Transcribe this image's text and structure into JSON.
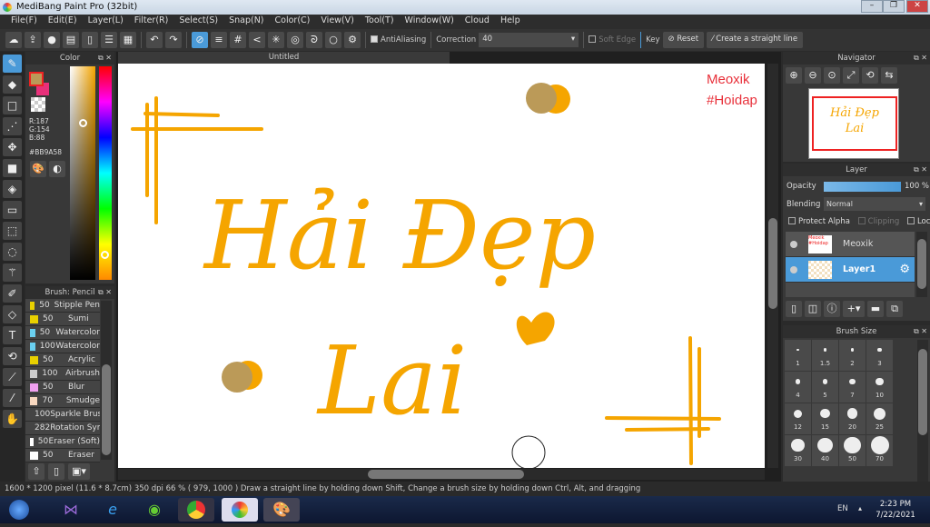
{
  "window": {
    "title": "MediBang Paint Pro (32bit)"
  },
  "menu": [
    "File(F)",
    "Edit(E)",
    "Layer(L)",
    "Filter(R)",
    "Select(S)",
    "Snap(N)",
    "Color(C)",
    "View(V)",
    "Tool(T)",
    "Window(W)",
    "Cloud",
    "Help"
  ],
  "toolbar": {
    "antialiasing_label": "AntiAliasing",
    "correction_label": "Correction",
    "correction_value": "40",
    "soft_edge_label": "Soft Edge",
    "key_label": "Key",
    "reset_label": "Reset",
    "straight_line_label": "Create a straight line"
  },
  "color_panel": {
    "title": "Color",
    "r": "R:187",
    "g": "G:154",
    "b": "B:88",
    "hex": "#BB9A58",
    "primary": "#BB9A58",
    "secondary": "#E8307A"
  },
  "brush_panel": {
    "title": "Brush: Pencil",
    "items": [
      {
        "size": "50",
        "name": "Stipple Pen",
        "color": "#e8d000"
      },
      {
        "size": "50",
        "name": "Sumi",
        "color": "#e8d000"
      },
      {
        "size": "50",
        "name": "Watercolor",
        "color": "#6ad0f0"
      },
      {
        "size": "100",
        "name": "Watercolor",
        "color": "#6ad0f0"
      },
      {
        "size": "50",
        "name": "Acrylic",
        "color": "#e8d000"
      },
      {
        "size": "100",
        "name": "Airbrush",
        "color": "#cccccc"
      },
      {
        "size": "50",
        "name": "Blur",
        "color": "#f0a0f0"
      },
      {
        "size": "70",
        "name": "Smudge",
        "color": "#f8d8c0"
      },
      {
        "size": "100",
        "name": "Sparkle Brush",
        "color": "#3050f0"
      },
      {
        "size": "282",
        "name": "Rotation Symmetry",
        "color": "#e82828"
      },
      {
        "size": "50",
        "name": "Eraser (Soft)",
        "color": "#ffffff"
      },
      {
        "size": "50",
        "name": "Eraser",
        "color": "#ffffff"
      }
    ]
  },
  "canvas": {
    "tab": "Untitled",
    "line1": "Hải Đẹp",
    "line2": "Lai",
    "watermark1": "Meoxik",
    "watermark2": "#Hoidap",
    "ink": "#F5A500"
  },
  "navigator": {
    "title": "Navigator",
    "thumb_line1": "Hải Đẹp",
    "thumb_line2": "Lai"
  },
  "layer_panel": {
    "title": "Layer",
    "opacity_label": "Opacity",
    "opacity_value": "100 %",
    "opacity": 100,
    "blending_label": "Blending",
    "blending_value": "Normal",
    "protect_alpha": "Protect Alpha",
    "clipping": "Clipping",
    "lock": "Lock",
    "layers": [
      {
        "name": "Meoxik",
        "thumb": "Meoxik #Hoidap"
      },
      {
        "name": "Layer1",
        "selected": true
      }
    ]
  },
  "brush_size": {
    "title": "Brush Size",
    "sizes": [
      "1",
      "1.5",
      "2",
      "3",
      "4",
      "5",
      "7",
      "10",
      "12",
      "15",
      "20",
      "25",
      "30",
      "40",
      "50",
      "70"
    ]
  },
  "status": "1600 * 1200 pixel  (11.6 * 8.7cm)  350 dpi  66 %  ( 979, 1000 )  Draw a straight line by holding down Shift, Change a brush size by holding down Ctrl, Alt, and dragging",
  "taskbar": {
    "lang": "EN",
    "time": "2:23 PM",
    "date": "7/22/2021"
  }
}
